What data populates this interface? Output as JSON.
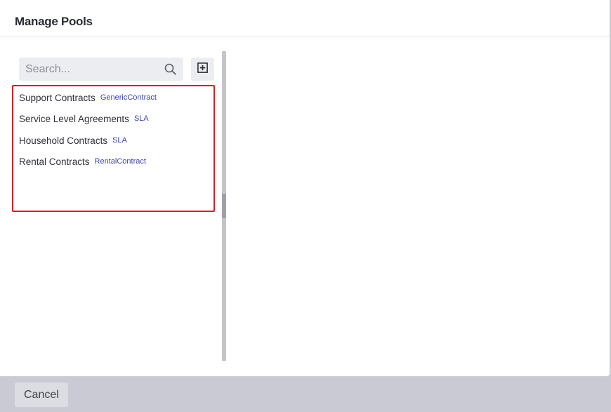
{
  "dialog": {
    "title": "Manage Pools"
  },
  "search": {
    "placeholder": "Search...",
    "value": "",
    "icon": "search-icon"
  },
  "add_button": {
    "icon": "plus-square-icon"
  },
  "pools": [
    {
      "name": "Support Contracts",
      "type": "GenericContract"
    },
    {
      "name": "Service Level Agreements",
      "type": "SLA"
    },
    {
      "name": "Household Contracts",
      "type": "SLA"
    },
    {
      "name": "Rental Contracts",
      "type": "RentalContract"
    }
  ],
  "footer": {
    "cancel_label": "Cancel"
  },
  "colors": {
    "highlight_border": "#d61f26",
    "type_tag": "#3a3fb5",
    "footer_bg": "#c9cad3"
  }
}
